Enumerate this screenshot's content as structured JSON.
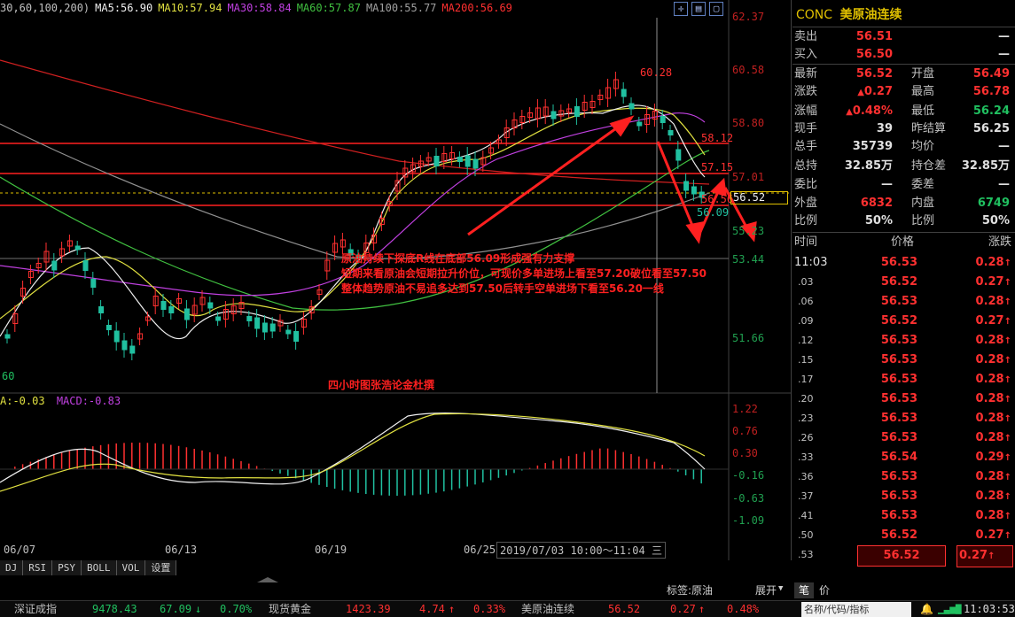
{
  "ma_bar": {
    "params": "30,60,100,200)",
    "ma5": "MA5:56.90",
    "ma10": "MA10:57.94",
    "ma30": "MA30:58.84",
    "ma60": "MA60:57.87",
    "ma100": "MA100:55.77",
    "ma200": "MA200:56.69"
  },
  "colors": {
    "up": "#ff3030",
    "down": "#20c0a0",
    "ma5": "#ffffff",
    "ma10": "#e0e040",
    "ma30": "#c040e0",
    "ma60": "#40c040",
    "ma100": "#a0a0a0",
    "ma200": "#d02020"
  },
  "price_axis": [
    "62.37",
    "60.58",
    "58.80",
    "57.01",
    "55.23",
    "53.44",
    "51.66"
  ],
  "macd_axis": [
    "1.22",
    "0.76",
    "0.30",
    "-0.16",
    "-0.63",
    "-1.09"
  ],
  "price_marks": {
    "high": "60.28",
    "r1": "58.12",
    "r2": "57.15",
    "r3": "56.56",
    "low": "56.09",
    "current": "56.52",
    "left_cut": "60"
  },
  "dates": [
    "06/07",
    "06/13",
    "06/19",
    "06/25"
  ],
  "cursor_label": "2019/07/03 10:00～11:04 三",
  "macd_bar": {
    "dea": "A:-0.03",
    "macd": "MACD:-0.83"
  },
  "annotation": {
    "line1": "原油持续下探底R线在底部56.09形成强有力支撑",
    "line2": "短期来看原油会短期拉升价位，可现价多单进场上看至57.20破位看至57.50",
    "line3": "整体趋势原油不易追多达到57.50后转手空单进场下看至56.20一线",
    "sign": "四小时图张浩论金杜撰"
  },
  "ind_tabs": [
    "DJ",
    "RSI",
    "PSY",
    "BOLL",
    "VOL",
    "设置"
  ],
  "bottom": {
    "tag_label": "标签:原油",
    "expand": "展开",
    "pen": "笔",
    "price": "价"
  },
  "status": {
    "idx1_name": "深证成指",
    "idx1_val": "9478.43",
    "idx1_chg": "67.09",
    "idx1_pct": "0.70%",
    "idx2_name": "现货黄金",
    "idx2_val": "1423.39",
    "idx2_chg": "4.74",
    "idx2_pct": "0.33%",
    "idx3_name": "美原油连续",
    "idx3_val": "56.52",
    "idx3_chg": "0.27",
    "idx3_pct": "0.48%",
    "search_placeholder": "名称/代码/指标",
    "clock": "11:03:53"
  },
  "panel": {
    "code": "CONC",
    "name": "美原油连续",
    "rows": [
      {
        "k": "卖出",
        "v": "56.51",
        "k2": "",
        "v2": "—"
      },
      {
        "k": "买入",
        "v": "56.50",
        "k2": "",
        "v2": "—"
      },
      {
        "k": "最新",
        "v": "56.52",
        "k2": "开盘",
        "v2": "56.49"
      },
      {
        "k": "涨跌",
        "v": "0.27",
        "k2": "最高",
        "v2": "56.78"
      },
      {
        "k": "涨幅",
        "v": "0.48%",
        "k2": "最低",
        "v2": "56.24"
      },
      {
        "k": "现手",
        "v": "39",
        "k2": "昨结算",
        "v2": "56.25"
      },
      {
        "k": "总手",
        "v": "35739",
        "k2": "均价",
        "v2": "—"
      },
      {
        "k": "总持",
        "v": "32.85万",
        "k2": "持仓差",
        "v2": "32.85万"
      },
      {
        "k": "委比",
        "v": "—",
        "k2": "委差",
        "v2": "—"
      },
      {
        "k": "外盘",
        "v": "6832",
        "k2": "内盘",
        "v2": "6749"
      },
      {
        "k": "比例",
        "v": "50%",
        "k2": "比例",
        "v2": "50%"
      }
    ],
    "tick_header": {
      "t": "时间",
      "p": "价格",
      "c": "涨跌"
    },
    "ticks": [
      {
        "t": "11:03",
        "p": "56.53",
        "c": "0.28"
      },
      {
        "t": ".03",
        "p": "56.52",
        "c": "0.27"
      },
      {
        "t": ".06",
        "p": "56.53",
        "c": "0.28"
      },
      {
        "t": ".09",
        "p": "56.52",
        "c": "0.27"
      },
      {
        "t": ".12",
        "p": "56.53",
        "c": "0.28"
      },
      {
        "t": ".15",
        "p": "56.53",
        "c": "0.28"
      },
      {
        "t": ".17",
        "p": "56.53",
        "c": "0.28"
      },
      {
        "t": ".20",
        "p": "56.53",
        "c": "0.28"
      },
      {
        "t": ".23",
        "p": "56.53",
        "c": "0.28"
      },
      {
        "t": ".26",
        "p": "56.53",
        "c": "0.28"
      },
      {
        "t": ".33",
        "p": "56.54",
        "c": "0.29"
      },
      {
        "t": ".36",
        "p": "56.53",
        "c": "0.28"
      },
      {
        "t": ".37",
        "p": "56.53",
        "c": "0.28"
      },
      {
        "t": ".41",
        "p": "56.53",
        "c": "0.28"
      },
      {
        "t": ".50",
        "p": "56.52",
        "c": "0.27"
      },
      {
        "t": ".53",
        "p": "56.52",
        "c": "0.27"
      }
    ]
  }
}
